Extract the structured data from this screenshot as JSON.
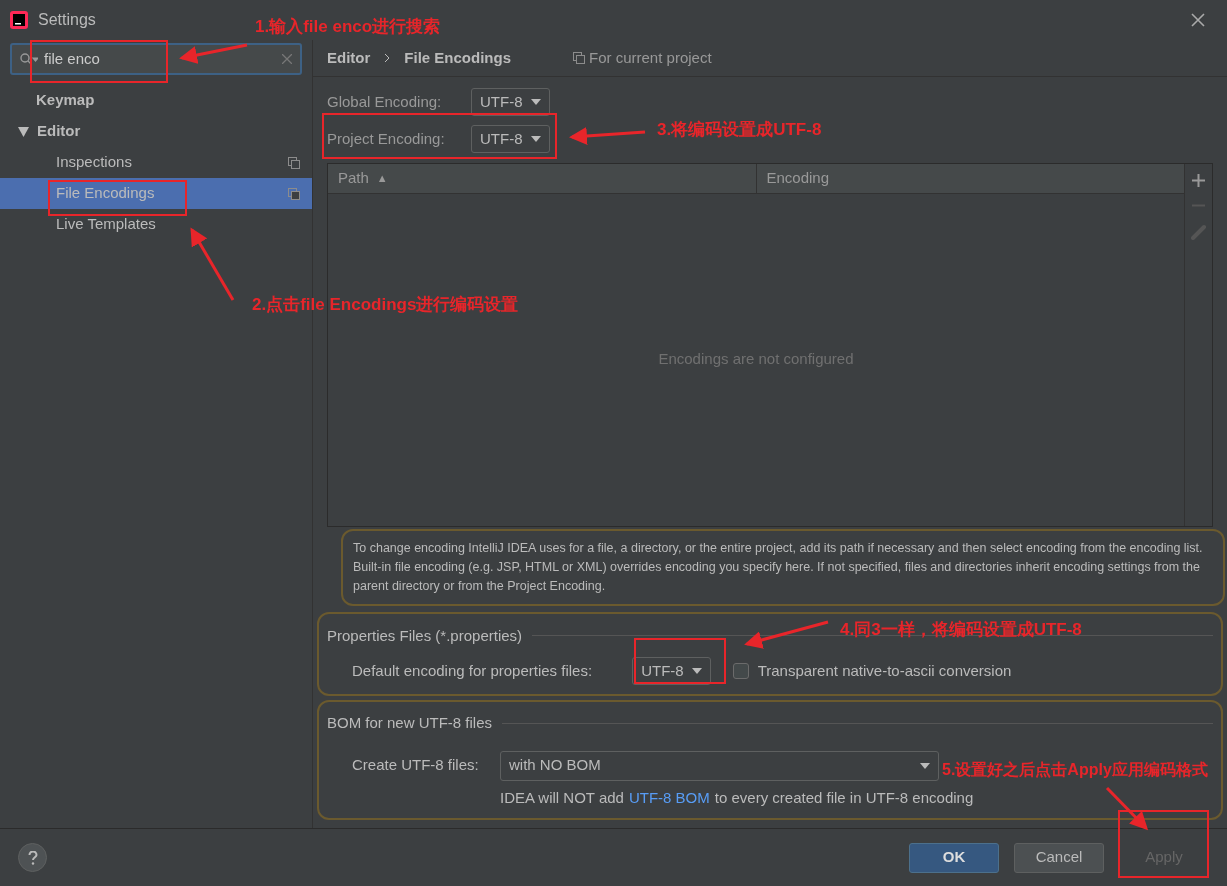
{
  "window": {
    "title": "Settings"
  },
  "search": {
    "value": "file enco"
  },
  "sidebar": {
    "items": [
      {
        "label": "Keymap",
        "selected": false,
        "copy": false
      },
      {
        "label": "Editor",
        "selected": false,
        "expanded": true,
        "copy": false,
        "children": [
          {
            "label": "Inspections",
            "selected": false,
            "copy": true
          },
          {
            "label": "File Encodings",
            "selected": true,
            "copy": true
          },
          {
            "label": "Live Templates",
            "selected": false,
            "copy": false
          }
        ]
      }
    ]
  },
  "breadcrumb": [
    "Editor",
    "File Encodings"
  ],
  "scope": "For current project",
  "encodings": [
    {
      "label": "Global Encoding:",
      "value": "UTF-8"
    },
    {
      "label": "Project Encoding:",
      "value": "UTF-8"
    }
  ],
  "table": {
    "columns": [
      {
        "label": "Path",
        "sort": "▲"
      },
      {
        "label": "Encoding"
      }
    ],
    "empty": "Encodings are not configured"
  },
  "info": "To change encoding IntelliJ IDEA uses for a file, a directory, or the entire project, add its path if necessary and then select encoding from the encoding list. Built-in file encoding (e.g. JSP, HTML or XML) overrides encoding you specify here. If not specified, files and directories inherit encoding settings from the parent directory or from the Project Encoding.",
  "properties": {
    "title": "Properties Files (*.properties)",
    "label": "Default encoding for properties files:",
    "value": "UTF-8",
    "checkbox": {
      "label": "Transparent native-to-ascii conversion",
      "checked": false
    }
  },
  "bom": {
    "title": "BOM for new UTF-8 files",
    "label": "Create UTF-8 files:",
    "value": "with NO BOM",
    "note_before": "IDEA will NOT add",
    "note_link": "UTF-8 BOM",
    "note_after": "to every created file in UTF-8 encoding"
  },
  "buttons": [
    {
      "label": "OK",
      "kind": "primary",
      "disabled": false
    },
    {
      "label": "Cancel",
      "kind": "normal",
      "disabled": false
    },
    {
      "label": "Apply",
      "kind": "normal",
      "disabled": true
    }
  ],
  "annotations": [
    "1.输入file enco进行搜索",
    "2.点击file Encodings进行编码设置",
    "3.将编码设置成UTF-8",
    "4.同3一样，将编码设置成UTF-8",
    "5.设置好之后点击Apply应用编码格式"
  ]
}
